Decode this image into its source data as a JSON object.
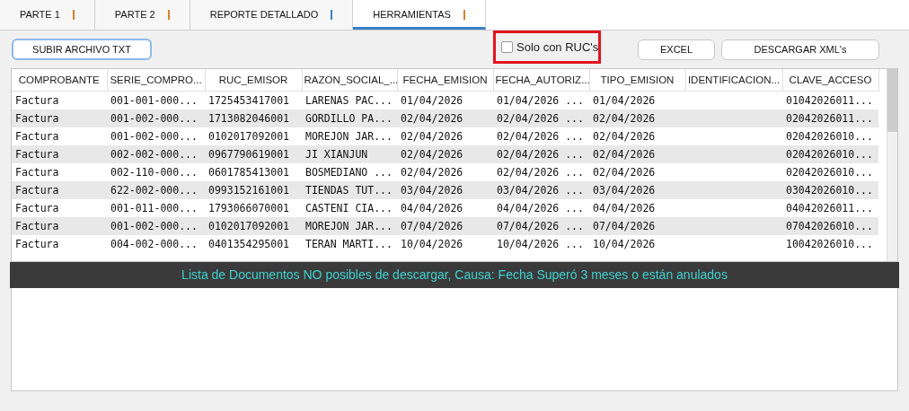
{
  "tabs": [
    {
      "label": "PARTE 1",
      "color": "#d4822a",
      "selected": false
    },
    {
      "label": "PARTE 2",
      "color": "#d4822a",
      "selected": false
    },
    {
      "label": "REPORTE DETALLADO",
      "color": "#3a7fc4",
      "selected": false
    },
    {
      "label": "HERRAMIENTAS",
      "color": "#d4822a",
      "selected": true
    }
  ],
  "upload_button": {
    "label": "SUBIR ARCHIVO TXT",
    "focused": true
  },
  "ruc_filter": {
    "label": "Solo con RUC's",
    "checked": false
  },
  "actions": [
    "EXCEL",
    "DESCARGAR XML's"
  ],
  "table": {
    "columns": [
      "COMPROBANTE",
      "SERIE_COMPRO...",
      "RUC_EMISOR",
      "RAZON_SOCIAL_...",
      "FECHA_EMISION",
      "FECHA_AUTORIZ...",
      "TIPO_EMISION",
      "IDENTIFICACION...",
      "CLAVE_ACCESO"
    ],
    "rows": [
      [
        "Factura",
        "001-001-000...",
        "1725453417001",
        "LARENAS PAC...",
        "01/04/2026",
        "01/04/2026 ...",
        "01/04/2026",
        "",
        "01042026011..."
      ],
      [
        "Factura",
        "001-002-000...",
        "1713082046001",
        "GORDILLO PA...",
        "02/04/2026",
        "02/04/2026 ...",
        "02/04/2026",
        "",
        "02042026011..."
      ],
      [
        "Factura",
        "001-002-000...",
        "0102017092001",
        "MOREJON JAR...",
        "02/04/2026",
        "02/04/2026 ...",
        "02/04/2026",
        "",
        "02042026010..."
      ],
      [
        "Factura",
        "002-002-000...",
        "0967790619001",
        "JI XIANJUN",
        "02/04/2026",
        "02/04/2026 ...",
        "02/04/2026",
        "",
        "02042026010..."
      ],
      [
        "Factura",
        "002-110-000...",
        "0601785413001",
        "BOSMEDIANO ...",
        "02/04/2026",
        "02/04/2026 ...",
        "02/04/2026",
        "",
        "02042026010..."
      ],
      [
        "Factura",
        "622-002-000...",
        "0993152161001",
        "TIENDAS TUT...",
        "03/04/2026",
        "03/04/2026 ...",
        "03/04/2026",
        "",
        "03042026010..."
      ],
      [
        "Factura",
        "001-011-000...",
        "1793066070001",
        "CASTENI CIA...",
        "04/04/2026",
        "04/04/2026 ...",
        "04/04/2026",
        "",
        "04042026011..."
      ],
      [
        "Factura",
        "001-002-000...",
        "0102017092001",
        "MOREJON JAR...",
        "07/04/2026",
        "07/04/2026 ...",
        "07/04/2026",
        "",
        "07042026010..."
      ],
      [
        "Factura",
        "004-002-000...",
        "0401354295001",
        "TERAN MARTI...",
        "10/04/2026",
        "10/04/2026 ...",
        "10/04/2026",
        "",
        "10042026010..."
      ]
    ]
  },
  "banner": "Lista de Documentos NO posibles de descargar, Causa: Fecha Superó 3 meses o están anulados"
}
